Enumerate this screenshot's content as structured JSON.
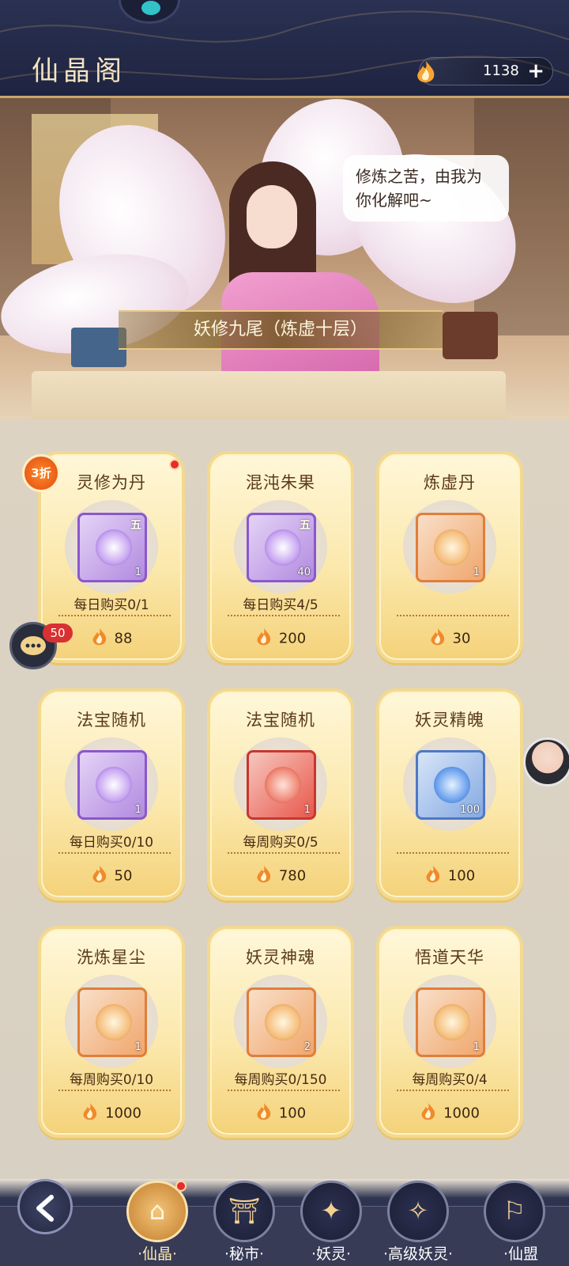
{
  "header": {
    "title": "仙晶阁",
    "currency_amount": "1138",
    "add_label": "+"
  },
  "banner": {
    "speech": "修炼之苦，由我为你化解吧~",
    "character_name": "妖修九尾（炼虚十层）"
  },
  "shop": {
    "discount_badge": "3折",
    "chat_badge": "50",
    "items": [
      {
        "name": "灵修为丹",
        "grade": "五",
        "qty": "1",
        "limit": "每日购买0/1",
        "price": "88",
        "frame": "purple"
      },
      {
        "name": "混沌朱果",
        "grade": "五",
        "qty": "40",
        "limit": "每日购买4/5",
        "price": "200",
        "frame": "purple"
      },
      {
        "name": "炼虚丹",
        "grade": "",
        "qty": "1",
        "limit": "",
        "price": "30",
        "frame": "orange"
      },
      {
        "name": "法宝随机",
        "grade": "",
        "qty": "1",
        "limit": "每日购买0/10",
        "price": "50",
        "frame": "purple"
      },
      {
        "name": "法宝随机",
        "grade": "",
        "qty": "1",
        "limit": "每周购买0/5",
        "price": "780",
        "frame": "red"
      },
      {
        "name": "妖灵精魄",
        "grade": "",
        "qty": "100",
        "limit": "",
        "price": "100",
        "frame": "blue"
      },
      {
        "name": "洗炼星尘",
        "grade": "",
        "qty": "1",
        "limit": "每周购买0/10",
        "price": "1000",
        "frame": "orange"
      },
      {
        "name": "妖灵神魂",
        "grade": "",
        "qty": "2",
        "limit": "每周购买0/150",
        "price": "100",
        "frame": "orange"
      },
      {
        "name": "悟道天华",
        "grade": "",
        "qty": "1",
        "limit": "每周购买0/4",
        "price": "1000",
        "frame": "orange"
      }
    ]
  },
  "nav": {
    "back_icon": "back-arrow-icon",
    "items": [
      {
        "label": "·仙晶·",
        "icon": "crystal-pavilion-icon"
      },
      {
        "label": "·秘市·",
        "icon": "secret-market-icon"
      },
      {
        "label": "·妖灵·",
        "icon": "demon-spirit-icon"
      },
      {
        "label": "·高级妖灵·",
        "icon": "advanced-demon-spirit-icon"
      },
      {
        "label": "·仙盟",
        "icon": "alliance-icon"
      }
    ]
  },
  "colors": {
    "header_bg": "#1e2440",
    "card_gold": "#f4d27a",
    "accent_orange": "#f08a2a",
    "badge_red": "#e82b2b"
  }
}
